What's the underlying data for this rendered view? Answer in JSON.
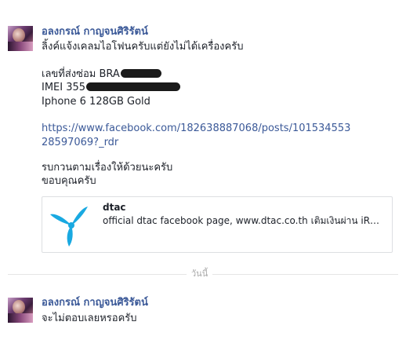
{
  "messages": [
    {
      "sender": "อลงกรณ์ กาญจนศิริรัตน์",
      "lines": [
        "ลิ้งค์แจ้งเคลมไอโฟนครับแต่ยังไม่ได้เครื่องครับ",
        "เลขที่ส่งซ่อม BRA",
        "IMEI 355",
        "Iphone 6 128GB Gold",
        "https://www.facebook.com/182638887068/posts/101534553",
        "28597069?_rdr",
        "รบกวนตามเรื่องให้ด้วยนะครับ",
        "ขอบคุณครับ"
      ],
      "attachment": {
        "title": "dtac",
        "description": "official dtac facebook page, www.dtac.co.th เติมเงินผ่าน iR…",
        "logo_color": "#19a9e1"
      }
    },
    {
      "sender": "อลงกรณ์ กาญจนศิริรัตน์",
      "lines": [
        "จะไม่ตอบเลยหรอครับ"
      ]
    }
  ],
  "divider": {
    "label": "วันนี้"
  }
}
